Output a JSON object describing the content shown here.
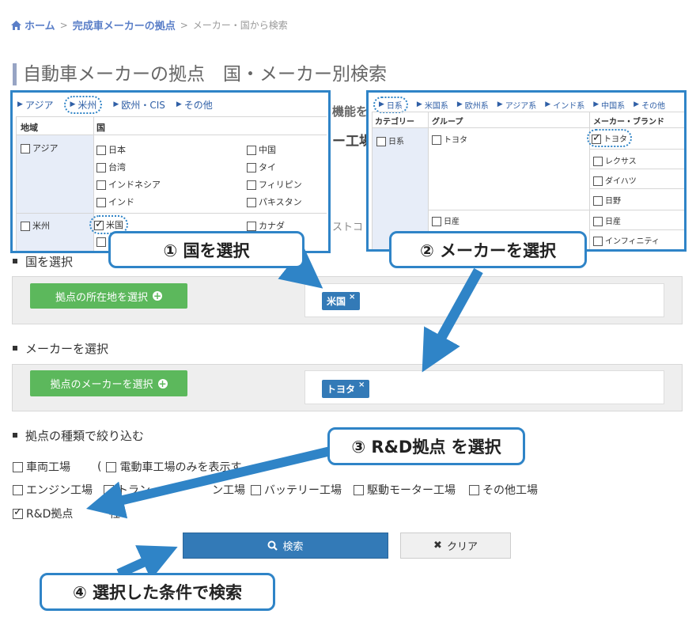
{
  "breadcrumb": {
    "home": "ホーム",
    "sep1": ">",
    "link": "完成車メーカーの拠点",
    "sep2": ">",
    "current": "メーカー・国から検索"
  },
  "page_title": "自動車メーカーの拠点　国・メーカー別検索",
  "underlying_fragments": {
    "frag1": "機能を追",
    "frag2": "ー工場",
    "frag3": "ストコ"
  },
  "country_panel": {
    "tabs": [
      "アジア",
      "米州",
      "欧州・CIS",
      "その他"
    ],
    "col_region": "地域",
    "col_country": "国",
    "region_asia": "アジア",
    "region_americas": "米州",
    "asia_countries": [
      "日本",
      "中国",
      "台湾",
      "タイ",
      "インドネシア",
      "フィリピン",
      "インド",
      "パキスタン"
    ],
    "americas_countries": [
      "米国",
      "カナダ"
    ]
  },
  "maker_panel": {
    "tabs": [
      "日系",
      "米国系",
      "欧州系",
      "アジア系",
      "インド系",
      "中国系",
      "その他"
    ],
    "col_category": "カテゴリー",
    "col_group": "グループ",
    "col_brand": "メーカー・ブランド",
    "category": "日系",
    "group_toyota": "トヨタ",
    "group_nissan": "日産",
    "brands": [
      "トヨタ",
      "レクサス",
      "ダイハツ",
      "日野",
      "日産",
      "インフィニティ"
    ]
  },
  "section_country": {
    "heading": "国を選択",
    "button": "拠点の所在地を選択",
    "selected": "米国",
    "chip_close": "×"
  },
  "section_maker": {
    "heading": "メーカーを選択",
    "button": "拠点のメーカーを選択",
    "selected": "トヨタ",
    "chip_close": "×"
  },
  "section_type": {
    "heading": "拠点の種類で絞り込む",
    "vehicle_plant": "車両工場",
    "paren": "(",
    "ev_only": "電動車工場のみを表示す",
    "engine": "エンジン工場",
    "transmission_prefix": "トラン",
    "transmission_suffix": "ン工場",
    "battery": "バッテリー工場",
    "motor": "駆動モーター工場",
    "other": "その他工場",
    "rnd": "R&D拠点",
    "rnd_suffix": "社"
  },
  "buttons": {
    "search": "検索",
    "clear": "クリア"
  },
  "callouts": {
    "step1": "① 国を選択",
    "step2": "② メーカーを選択",
    "step3": "③ R&D拠点  を選択",
    "step4": "④ 選択した条件で検索"
  },
  "colors": {
    "accent_blue": "#2f84c7",
    "chip_blue": "#337ab7",
    "green_button": "#5cb85c",
    "link_blue": "#5b7fc8"
  },
  "icons": {
    "home": "home-icon",
    "search": "search-icon",
    "clear": "close-icon",
    "add": "plus-circle-icon"
  }
}
